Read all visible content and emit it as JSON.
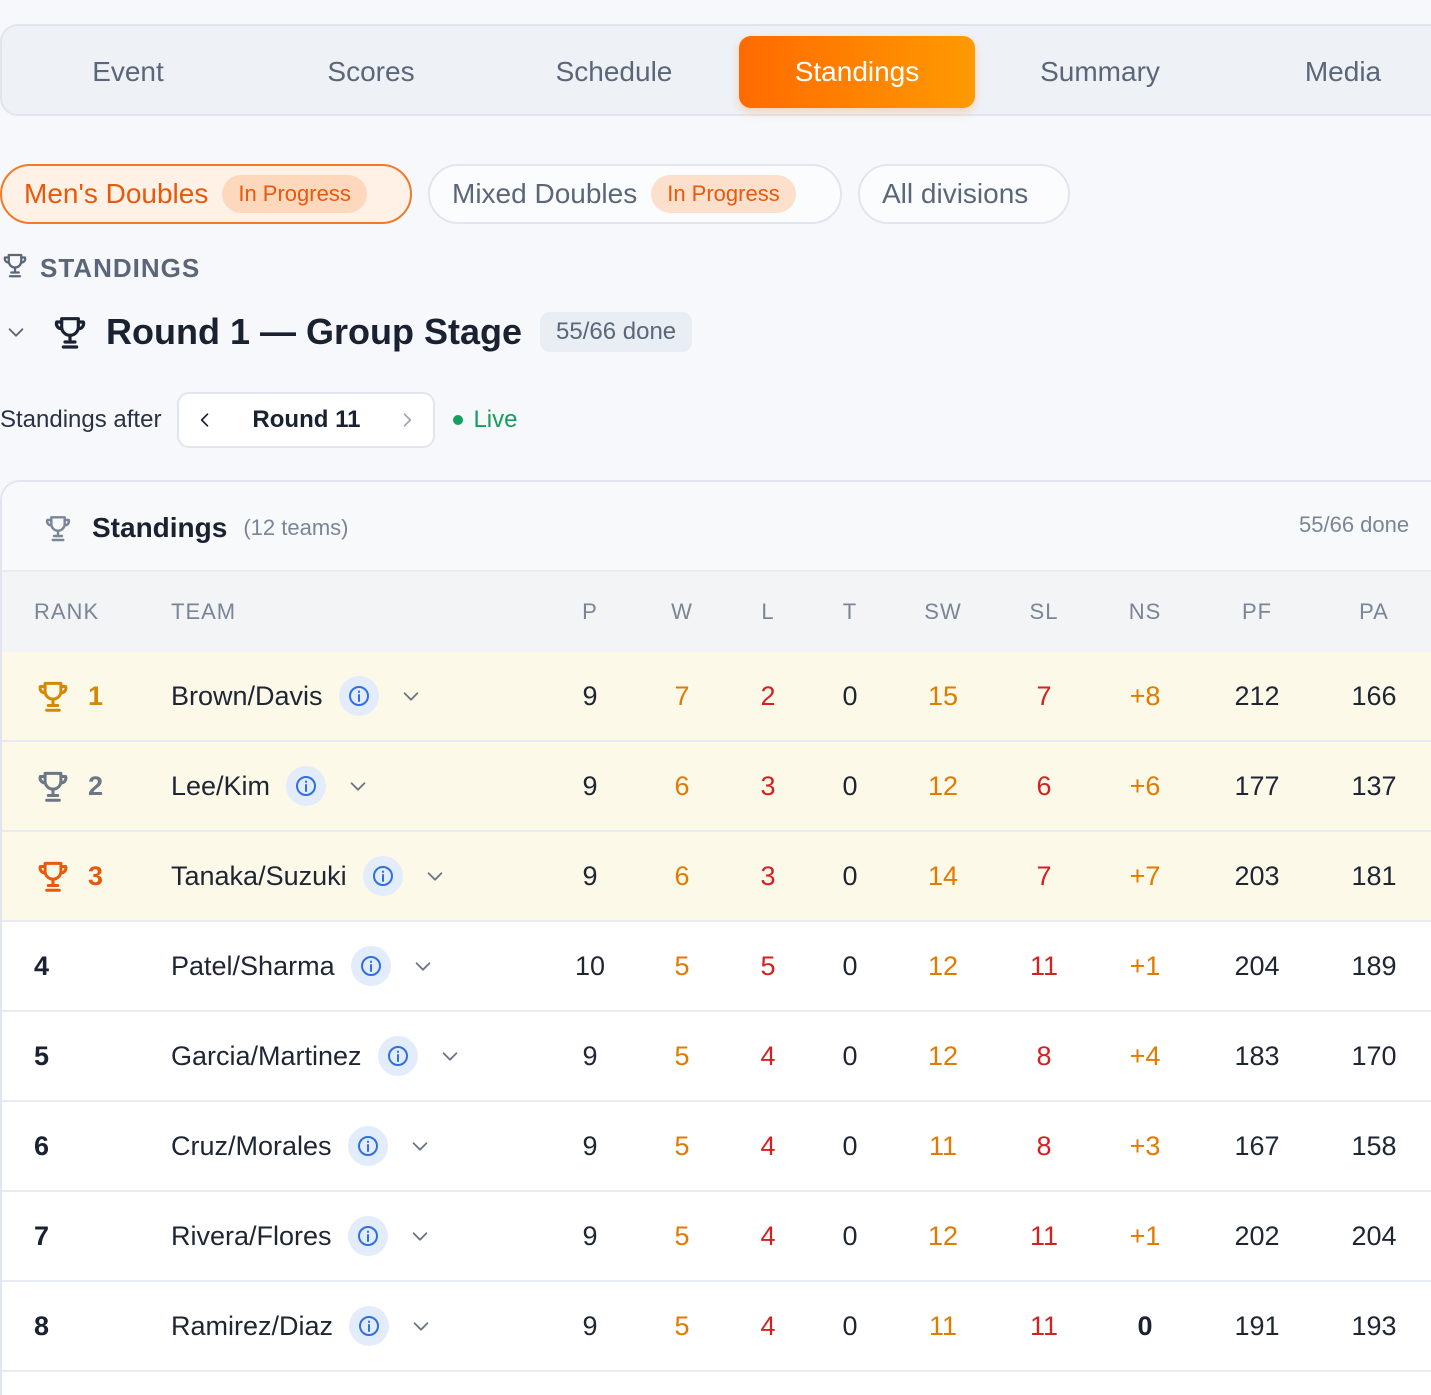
{
  "nav": {
    "tabs": [
      {
        "label": "Event"
      },
      {
        "label": "Scores"
      },
      {
        "label": "Schedule"
      },
      {
        "label": "Standings",
        "active": true
      },
      {
        "label": "Summary"
      },
      {
        "label": "Media"
      }
    ]
  },
  "divisions": [
    {
      "label": "Men's Doubles",
      "badge": "In Progress",
      "active": true
    },
    {
      "label": "Mixed Doubles",
      "badge": "In Progress",
      "active": false
    },
    {
      "label": "All divisions",
      "active": false
    }
  ],
  "section": {
    "label": "STANDINGS",
    "round_title": "Round 1 — Group Stage",
    "round_progress": "55/66 done",
    "after_label": "Standings after",
    "round_value": "Round 11",
    "live_label": "Live"
  },
  "card": {
    "title": "Standings",
    "subtitle": "(12 teams)",
    "progress": "55/66 done"
  },
  "table": {
    "headers": [
      "RANK",
      "TEAM",
      "P",
      "W",
      "L",
      "T",
      "SW",
      "SL",
      "NS",
      "PF",
      "PA"
    ],
    "rows": [
      {
        "rank": "1",
        "team": "Brown/Davis",
        "p": "9",
        "w": "7",
        "l": "2",
        "t": "0",
        "sw": "15",
        "sl": "7",
        "ns": "+8",
        "pf": "212",
        "pa": "166"
      },
      {
        "rank": "2",
        "team": "Lee/Kim",
        "p": "9",
        "w": "6",
        "l": "3",
        "t": "0",
        "sw": "12",
        "sl": "6",
        "ns": "+6",
        "pf": "177",
        "pa": "137"
      },
      {
        "rank": "3",
        "team": "Tanaka/Suzuki",
        "p": "9",
        "w": "6",
        "l": "3",
        "t": "0",
        "sw": "14",
        "sl": "7",
        "ns": "+7",
        "pf": "203",
        "pa": "181"
      },
      {
        "rank": "4",
        "team": "Patel/Sharma",
        "p": "10",
        "w": "5",
        "l": "5",
        "t": "0",
        "sw": "12",
        "sl": "11",
        "ns": "+1",
        "pf": "204",
        "pa": "189"
      },
      {
        "rank": "5",
        "team": "Garcia/Martinez",
        "p": "9",
        "w": "5",
        "l": "4",
        "t": "0",
        "sw": "12",
        "sl": "8",
        "ns": "+4",
        "pf": "183",
        "pa": "170"
      },
      {
        "rank": "6",
        "team": "Cruz/Morales",
        "p": "9",
        "w": "5",
        "l": "4",
        "t": "0",
        "sw": "11",
        "sl": "8",
        "ns": "+3",
        "pf": "167",
        "pa": "158"
      },
      {
        "rank": "7",
        "team": "Rivera/Flores",
        "p": "9",
        "w": "5",
        "l": "4",
        "t": "0",
        "sw": "12",
        "sl": "11",
        "ns": "+1",
        "pf": "202",
        "pa": "204"
      },
      {
        "rank": "8",
        "team": "Ramirez/Diaz",
        "p": "9",
        "w": "5",
        "l": "4",
        "t": "0",
        "sw": "11",
        "sl": "11",
        "ns": "0",
        "pf": "191",
        "pa": "193"
      }
    ]
  },
  "colors": {
    "accent": "#ff7a00",
    "gold": "#d48806",
    "silver": "#6b7686",
    "bronze": "#e8590c",
    "win": "#e07b00",
    "loss": "#d61f1f",
    "live": "#12a05c",
    "info": "#2f6fe0"
  },
  "icons": {
    "trophy": "trophy-icon",
    "chevron_down": "chevron-down-icon",
    "chevron_left": "chevron-left-icon",
    "chevron_right": "chevron-right-icon",
    "info": "info-icon"
  }
}
